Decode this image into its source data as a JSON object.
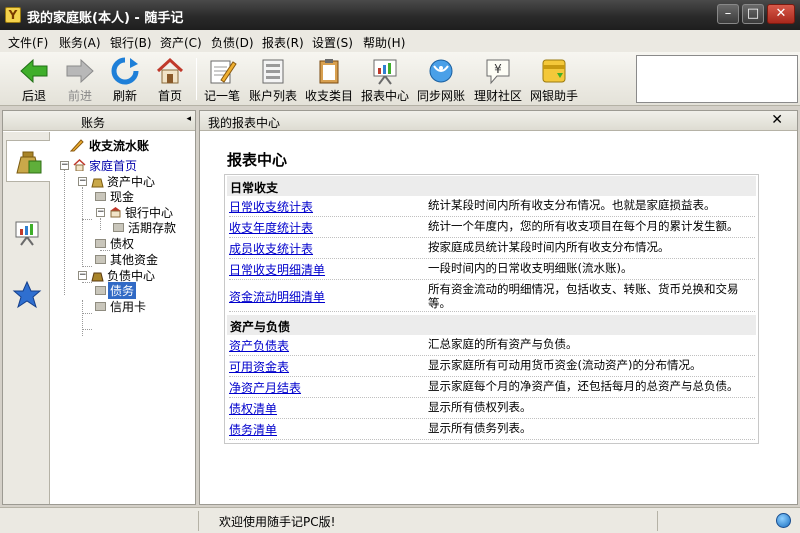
{
  "window": {
    "app_icon": "Y",
    "title": "我的家庭账(本人) - 随手记",
    "min_glyph": "–",
    "max_glyph": "□",
    "close_glyph": "✕"
  },
  "menu": [
    "文件(F)",
    "账务(A)",
    "银行(B)",
    "资产(C)",
    "负债(D)",
    "报表(R)",
    "设置(S)",
    "帮助(H)"
  ],
  "toolbar": {
    "back": "后退",
    "forward": "前进",
    "refresh": "刷新",
    "home": "首页",
    "record": "记一笔",
    "accounts": "账户列表",
    "categories": "收支类目",
    "reports": "报表中心",
    "sync": "同步网账",
    "community": "理财社区",
    "bank_helper": "网银助手",
    "community_symbol": "¥"
  },
  "left_panel": {
    "title": "账务",
    "collapse_arrow": "◂",
    "tree": {
      "root": "收支流水账",
      "home": "家庭首页",
      "assets": "资产中心",
      "cash": "现金",
      "bank": "银行中心",
      "deposit": "活期存款",
      "claims": "债权",
      "other_funds": "其他资金",
      "liabilities": "负债中心",
      "debt": "债务",
      "credit_card": "信用卡",
      "minus": "−"
    }
  },
  "right_panel": {
    "tab_title": "我的报表中心",
    "close_glyph": "✕",
    "heading": "报表中心",
    "sections": [
      {
        "title": "日常收支",
        "rows": [
          {
            "link": "日常收支统计表",
            "desc": "统计某段时间内所有收支分布情况。也就是家庭损益表。"
          },
          {
            "link": "收支年度统计表",
            "desc": "统计一个年度内，您的所有收支项目在每个月的累计发生额。"
          },
          {
            "link": "成员收支统计表",
            "desc": "按家庭成员统计某段时间内所有收支分布情况。"
          },
          {
            "link": "日常收支明细清单",
            "desc": "一段时间内的日常收支明细账(流水账)。"
          },
          {
            "link": "资金流动明细清单",
            "desc": "所有资金流动的明细情况，包括收支、转账、货币兑换和交易等。"
          }
        ]
      },
      {
        "title": "资产与负债",
        "rows": [
          {
            "link": "资产负债表",
            "desc": "汇总家庭的所有资产与负债。"
          },
          {
            "link": "可用资金表",
            "desc": "显示家庭所有可动用货币资金(流动资产)的分布情况。"
          },
          {
            "link": "净资产月结表",
            "desc": "显示家庭每个月的净资产值，还包括每月的总资产与总负债。"
          },
          {
            "link": "债权清单",
            "desc": "显示所有债权列表。"
          },
          {
            "link": "债务清单",
            "desc": "显示所有债务列表。"
          }
        ]
      }
    ]
  },
  "status": {
    "message": "欢迎使用随手记PC版!"
  },
  "colors": {
    "link": "#0000cc",
    "selection": "#316ac5",
    "titlebar": "#2a2a2a"
  }
}
